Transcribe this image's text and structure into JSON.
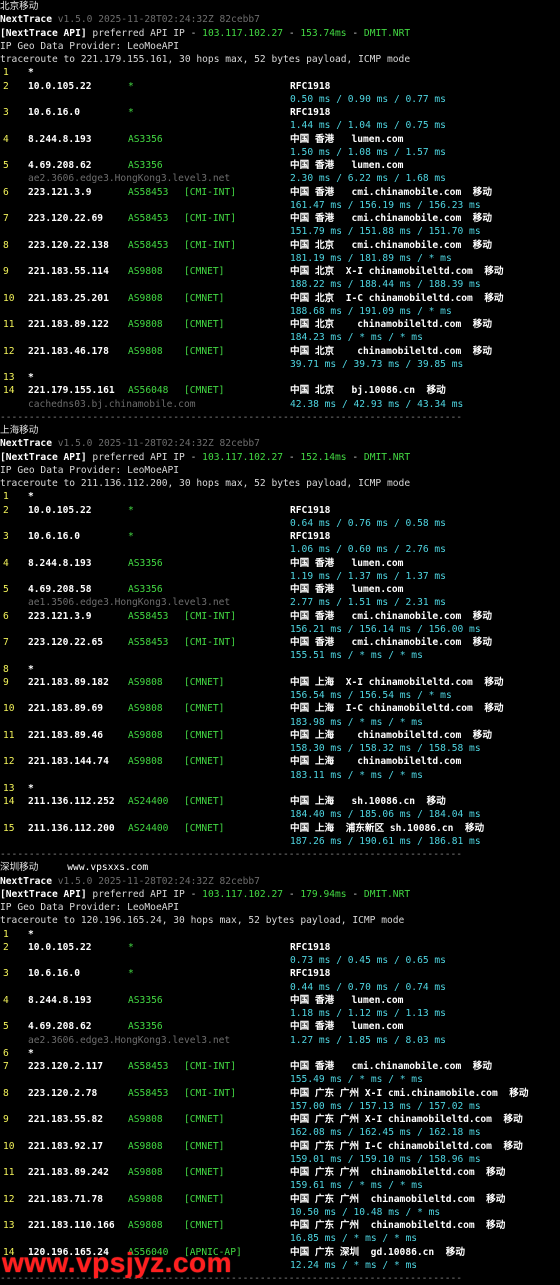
{
  "header": {
    "product": "NextTrace",
    "version": "v1.5.0 2025-11-28T02:24:32Z 82cebb7",
    "api_tag": "[NextTrace API]",
    "api_text": "preferred API IP -",
    "api_ip": "103.117.102.27",
    "api_host": "DMIT.NRT",
    "geo": "IP Geo Data Provider: LeoMoeAPI"
  },
  "separator": "--------------------------------------------------------------------------------",
  "watermark": "www.vpsjyz.com",
  "site_tag": "www.vpsxxs.com",
  "sections": [
    {
      "title": "北京移动",
      "api_latency": "153.74ms",
      "traceroute": "traceroute to 221.179.155.161, 30 hops max, 52 bytes payload, ICMP mode",
      "hops": [
        {
          "n": "1",
          "ip": "*",
          "asn": "",
          "tag": "",
          "geo": "",
          "times": "",
          "rdns": ""
        },
        {
          "n": "2",
          "ip": "10.0.105.22",
          "asn": "*",
          "tag": "",
          "geo": "RFC1918",
          "times": "0.50 ms / 0.90 ms / 0.77 ms",
          "rdns": ""
        },
        {
          "n": "3",
          "ip": "10.6.16.0",
          "asn": "*",
          "tag": "",
          "geo": "RFC1918",
          "times": "1.44 ms / 1.04 ms / 0.75 ms",
          "rdns": ""
        },
        {
          "n": "4",
          "ip": "8.244.8.193",
          "asn": "AS3356",
          "tag": "",
          "geo": "中国 香港   lumen.com",
          "times": "1.50 ms / 1.08 ms / 1.57 ms",
          "rdns": ""
        },
        {
          "n": "5",
          "ip": "4.69.208.62",
          "asn": "AS3356",
          "tag": "",
          "geo": "中国 香港   lumen.com",
          "times": "2.30 ms / 6.22 ms / 1.68 ms",
          "rdns": "ae2.3606.edge3.HongKong3.level3.net"
        },
        {
          "n": "6",
          "ip": "223.121.3.9",
          "asn": "AS58453",
          "tag": "[CMI-INT]",
          "geo": "中国 香港   cmi.chinamobile.com  移动",
          "times": "161.47 ms / 156.19 ms / 156.23 ms",
          "rdns": ""
        },
        {
          "n": "7",
          "ip": "223.120.22.69",
          "asn": "AS58453",
          "tag": "[CMI-INT]",
          "geo": "中国 香港   cmi.chinamobile.com  移动",
          "times": "151.79 ms / 151.88 ms / 151.70 ms",
          "rdns": ""
        },
        {
          "n": "8",
          "ip": "223.120.22.138",
          "asn": "AS58453",
          "tag": "[CMI-INT]",
          "geo": "中国 北京   cmi.chinamobile.com  移动",
          "times": "181.19 ms / 181.89 ms / * ms",
          "rdns": ""
        },
        {
          "n": "9",
          "ip": "221.183.55.114",
          "asn": "AS9808",
          "tag": "[CMNET]",
          "geo": "中国 北京  X-I chinamobileltd.com  移动",
          "times": "188.22 ms / 188.44 ms / 188.39 ms",
          "rdns": ""
        },
        {
          "n": "10",
          "ip": "221.183.25.201",
          "asn": "AS9808",
          "tag": "[CMNET]",
          "geo": "中国 北京  I-C chinamobileltd.com  移动",
          "times": "188.68 ms / 191.09 ms / * ms",
          "rdns": ""
        },
        {
          "n": "11",
          "ip": "221.183.89.122",
          "asn": "AS9808",
          "tag": "[CMNET]",
          "geo": "中国 北京    chinamobileltd.com  移动",
          "times": "184.23 ms / * ms / * ms",
          "rdns": ""
        },
        {
          "n": "12",
          "ip": "221.183.46.178",
          "asn": "AS9808",
          "tag": "[CMNET]",
          "geo": "中国 北京    chinamobileltd.com  移动",
          "times": "39.71 ms / 39.73 ms / 39.85 ms",
          "rdns": ""
        },
        {
          "n": "13",
          "ip": "*",
          "asn": "",
          "tag": "",
          "geo": "",
          "times": "",
          "rdns": ""
        },
        {
          "n": "14",
          "ip": "221.179.155.161",
          "asn": "AS56048",
          "tag": "[CMNET]",
          "geo": "中国 北京   bj.10086.cn  移动",
          "times": "42.38 ms / 42.93 ms / 43.34 ms",
          "rdns": "cachedns03.bj.chinamobile.com"
        }
      ]
    },
    {
      "title": "上海移动",
      "api_latency": "152.14ms",
      "traceroute": "traceroute to 211.136.112.200, 30 hops max, 52 bytes payload, ICMP mode",
      "hops": [
        {
          "n": "1",
          "ip": "*",
          "asn": "",
          "tag": "",
          "geo": "",
          "times": "",
          "rdns": ""
        },
        {
          "n": "2",
          "ip": "10.0.105.22",
          "asn": "*",
          "tag": "",
          "geo": "RFC1918",
          "times": "0.64 ms / 0.76 ms / 0.58 ms",
          "rdns": ""
        },
        {
          "n": "3",
          "ip": "10.6.16.0",
          "asn": "*",
          "tag": "",
          "geo": "RFC1918",
          "times": "1.06 ms / 0.60 ms / 2.76 ms",
          "rdns": ""
        },
        {
          "n": "4",
          "ip": "8.244.8.193",
          "asn": "AS3356",
          "tag": "",
          "geo": "中国 香港   lumen.com",
          "times": "1.19 ms / 1.37 ms / 1.37 ms",
          "rdns": ""
        },
        {
          "n": "5",
          "ip": "4.69.208.58",
          "asn": "AS3356",
          "tag": "",
          "geo": "中国 香港   lumen.com",
          "times": "2.77 ms / 1.51 ms / 2.31 ms",
          "rdns": "ae1.3506.edge3.HongKong3.level3.net"
        },
        {
          "n": "6",
          "ip": "223.121.3.9",
          "asn": "AS58453",
          "tag": "[CMI-INT]",
          "geo": "中国 香港   cmi.chinamobile.com  移动",
          "times": "156.21 ms / 156.14 ms / 156.00 ms",
          "rdns": ""
        },
        {
          "n": "7",
          "ip": "223.120.22.65",
          "asn": "AS58453",
          "tag": "[CMI-INT]",
          "geo": "中国 香港   cmi.chinamobile.com  移动",
          "times": "155.51 ms / * ms / * ms",
          "rdns": ""
        },
        {
          "n": "8",
          "ip": "*",
          "asn": "",
          "tag": "",
          "geo": "",
          "times": "",
          "rdns": ""
        },
        {
          "n": "9",
          "ip": "221.183.89.182",
          "asn": "AS9808",
          "tag": "[CMNET]",
          "geo": "中国 上海  X-I chinamobileltd.com  移动",
          "times": "156.54 ms / 156.54 ms / * ms",
          "rdns": ""
        },
        {
          "n": "10",
          "ip": "221.183.89.69",
          "asn": "AS9808",
          "tag": "[CMNET]",
          "geo": "中国 上海  I-C chinamobileltd.com  移动",
          "times": "183.98 ms / * ms / * ms",
          "rdns": ""
        },
        {
          "n": "11",
          "ip": "221.183.89.46",
          "asn": "AS9808",
          "tag": "[CMNET]",
          "geo": "中国 上海    chinamobileltd.com  移动",
          "times": "158.30 ms / 158.32 ms / 158.58 ms",
          "rdns": ""
        },
        {
          "n": "12",
          "ip": "221.183.144.74",
          "asn": "AS9808",
          "tag": "[CMNET]",
          "geo": "中国 上海    chinamobileltd.com",
          "times": "183.11 ms / * ms / * ms",
          "rdns": ""
        },
        {
          "n": "13",
          "ip": "*",
          "asn": "",
          "tag": "",
          "geo": "",
          "times": "",
          "rdns": ""
        },
        {
          "n": "14",
          "ip": "211.136.112.252",
          "asn": "AS24400",
          "tag": "[CMNET]",
          "geo": "中国 上海   sh.10086.cn  移动",
          "times": "184.40 ms / 185.06 ms / 184.04 ms",
          "rdns": ""
        },
        {
          "n": "15",
          "ip": "211.136.112.200",
          "asn": "AS24400",
          "tag": "[CMNET]",
          "geo": "中国 上海  浦东新区 sh.10086.cn  移动",
          "times": "187.26 ms / 190.61 ms / 186.81 ms",
          "rdns": ""
        }
      ]
    },
    {
      "title": "深圳移动",
      "api_latency": "179.94ms",
      "traceroute": "traceroute to 120.196.165.24, 30 hops max, 52 bytes payload, ICMP mode",
      "hops": [
        {
          "n": "1",
          "ip": "*",
          "asn": "",
          "tag": "",
          "geo": "",
          "times": "",
          "rdns": ""
        },
        {
          "n": "2",
          "ip": "10.0.105.22",
          "asn": "*",
          "tag": "",
          "geo": "RFC1918",
          "times": "0.73 ms / 0.45 ms / 0.65 ms",
          "rdns": ""
        },
        {
          "n": "3",
          "ip": "10.6.16.0",
          "asn": "*",
          "tag": "",
          "geo": "RFC1918",
          "times": "0.44 ms / 0.70 ms / 0.74 ms",
          "rdns": ""
        },
        {
          "n": "4",
          "ip": "8.244.8.193",
          "asn": "AS3356",
          "tag": "",
          "geo": "中国 香港   lumen.com",
          "times": "1.18 ms / 1.12 ms / 1.13 ms",
          "rdns": ""
        },
        {
          "n": "5",
          "ip": "4.69.208.62",
          "asn": "AS3356",
          "tag": "",
          "geo": "中国 香港   lumen.com",
          "times": "1.27 ms / 1.85 ms / 8.03 ms",
          "rdns": "ae2.3606.edge3.HongKong3.level3.net"
        },
        {
          "n": "6",
          "ip": "*",
          "asn": "",
          "tag": "",
          "geo": "",
          "times": "",
          "rdns": ""
        },
        {
          "n": "7",
          "ip": "223.120.2.117",
          "asn": "AS58453",
          "tag": "[CMI-INT]",
          "geo": "中国 香港   cmi.chinamobile.com  移动",
          "times": "155.49 ms / * ms / * ms",
          "rdns": ""
        },
        {
          "n": "8",
          "ip": "223.120.2.78",
          "asn": "AS58453",
          "tag": "[CMI-INT]",
          "geo": "中国 广东 广州 X-I cmi.chinamobile.com  移动",
          "times": "157.00 ms / 157.13 ms / 157.02 ms",
          "rdns": ""
        },
        {
          "n": "9",
          "ip": "221.183.55.82",
          "asn": "AS9808",
          "tag": "[CMNET]",
          "geo": "中国 广东 广州 X-I chinamobileltd.com  移动",
          "times": "162.08 ms / 162.45 ms / 162.18 ms",
          "rdns": ""
        },
        {
          "n": "10",
          "ip": "221.183.92.17",
          "asn": "AS9808",
          "tag": "[CMNET]",
          "geo": "中国 广东 广州 I-C chinamobileltd.com  移动",
          "times": "159.01 ms / 159.10 ms / 158.96 ms",
          "rdns": ""
        },
        {
          "n": "11",
          "ip": "221.183.89.242",
          "asn": "AS9808",
          "tag": "[CMNET]",
          "geo": "中国 广东 广州  chinamobileltd.com  移动",
          "times": "159.61 ms / * ms / * ms",
          "rdns": ""
        },
        {
          "n": "12",
          "ip": "221.183.71.78",
          "asn": "AS9808",
          "tag": "[CMNET]",
          "geo": "中国 广东 广州  chinamobileltd.com  移动",
          "times": "10.50 ms / 10.48 ms / * ms",
          "rdns": ""
        },
        {
          "n": "13",
          "ip": "221.183.110.166",
          "asn": "AS9808",
          "tag": "[CMNET]",
          "geo": "中国 广东 广州  chinamobileltd.com  移动",
          "times": "16.85 ms / * ms / * ms",
          "rdns": ""
        },
        {
          "n": "14",
          "ip": "120.196.165.24",
          "asn": "AS56040",
          "tag": "[APNIC-AP]",
          "geo": "中国 广东 深圳  gd.10086.cn  移动",
          "times": "12.24 ms / * ms / * ms",
          "rdns": ""
        }
      ]
    }
  ]
}
